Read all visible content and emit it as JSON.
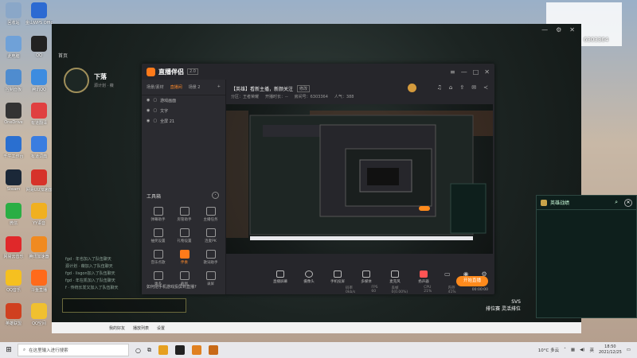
{
  "desktop_icons": [
    {
      "label": "回收站",
      "color": "#8aa7c8"
    },
    {
      "label": "金山WPS Office",
      "color": "#2c6ad2"
    },
    {
      "label": "此电脑",
      "color": "#6fa1d8"
    },
    {
      "label": "QQ",
      "color": "#222222"
    },
    {
      "label": "控制面板",
      "color": "#4f8ccf"
    },
    {
      "label": "腾讯QQ",
      "color": "#3d8ce0"
    },
    {
      "label": "OneDrive",
      "color": "#333333"
    },
    {
      "label": "有道翻译",
      "color": "#e04040"
    },
    {
      "label": "千牛工作台",
      "color": "#2a6fd0"
    },
    {
      "label": "有道词典",
      "color": "#3a7de0"
    },
    {
      "label": "Steam",
      "color": "#1b2838"
    },
    {
      "label": "网易UU加速器",
      "color": "#d6322a"
    },
    {
      "label": "微信",
      "color": "#2aae44"
    },
    {
      "label": "YY语音",
      "color": "#f0b020"
    },
    {
      "label": "网易云音乐",
      "color": "#e0282a"
    },
    {
      "label": "腾讯加速器",
      "color": "#f08a20"
    },
    {
      "label": "QQ音乐",
      "color": "#f5c020"
    },
    {
      "label": "斗鱼直播",
      "color": "#ff6a1a"
    },
    {
      "label": "英雄联盟",
      "color": "#d04020"
    },
    {
      "label": "QQ空间",
      "color": "#f0c030"
    }
  ],
  "game": {
    "home_label": "首页",
    "controls": [
      "—",
      "⚙",
      "✕"
    ],
    "player_name": "下落",
    "player_sub": "源计划 · 薇",
    "chat_lines": [
      "fgd · 年也加入了队伍聊天",
      "源计划 · 薇加入了队伍聊天",
      "fgd · lisgon加入了队伍聊天",
      "fgd · 年在凯加入了队伍聊天",
      "f · 传统长发又加入了队伍聊天"
    ],
    "rank_top": "SVS",
    "rank_mode": "排位赛 灵活排位",
    "battle_title": "英雄战绩",
    "battle_icons": [
      "search-icon",
      "close-icon"
    ],
    "bottom_bar": [
      "我的好友",
      "播放列表",
      "设置"
    ]
  },
  "overlay": {
    "id_number": "6303364"
  },
  "app": {
    "name": "直播伴侣",
    "version": "2.0",
    "scene_tabs": [
      "场景/素材",
      "直播间",
      "场景 2"
    ],
    "active_scene": 1,
    "sources": [
      "游戏画面",
      "文字",
      "全屏 21"
    ],
    "tools_title": "工具箱",
    "tools": [
      {
        "label": "弹幕助手",
        "hot": false
      },
      {
        "label": "房管助手",
        "hot": false
      },
      {
        "label": "主播任务",
        "hot": false
      },
      {
        "label": "抽奖设置",
        "hot": false
      },
      {
        "label": "礼物设置",
        "hot": false
      },
      {
        "label": "连麦PK",
        "hot": false
      },
      {
        "label": "音乐点歌",
        "hot": false
      },
      {
        "label": "伴奏",
        "hot": true
      },
      {
        "label": "歌词助手",
        "hot": false
      },
      {
        "label": "更多",
        "hot": false
      },
      {
        "label": "截图",
        "hot": false
      },
      {
        "label": "录屏",
        "hot": false
      }
    ],
    "notice": "如何把手机游戏投屏到直播?",
    "live_title": "【英雄】看新主播，新颜关注",
    "edit_label": "修改",
    "meta": [
      "分区：王者荣耀",
      "开播时长：--",
      "房间号：6303364",
      "人气：388"
    ],
    "top_icons": [
      "bell-icon",
      "lock-icon",
      "share-icon",
      "gift-icon",
      "mail-icon"
    ],
    "toolbar": [
      {
        "label": "直播屏幕",
        "icon": "screen-icon"
      },
      {
        "label": "摄像头",
        "icon": "camera-icon"
      },
      {
        "label": "手机投屏",
        "icon": "phone-icon"
      },
      {
        "label": "多媒体",
        "icon": "media-icon"
      },
      {
        "label": "麦克风",
        "icon": "mic-icon"
      },
      {
        "label": "扬声器",
        "icon": "speaker-icon"
      }
    ],
    "start_label": "开始直播",
    "status": [
      "码率 0kb/s",
      "FPS 60",
      "丢帧 0(0.00%)",
      "CPU 21%",
      "内存 41%"
    ],
    "timer": "00:00:00"
  },
  "taskbar": {
    "search_placeholder": "在这里输入进行搜索",
    "pinned_colors": [
      "#e6a020",
      "#222222",
      "#e08020",
      "#c86a18"
    ],
    "weather": "10°C 多云",
    "ime": "英",
    "time": "18:50",
    "date": "2021/12/25"
  }
}
